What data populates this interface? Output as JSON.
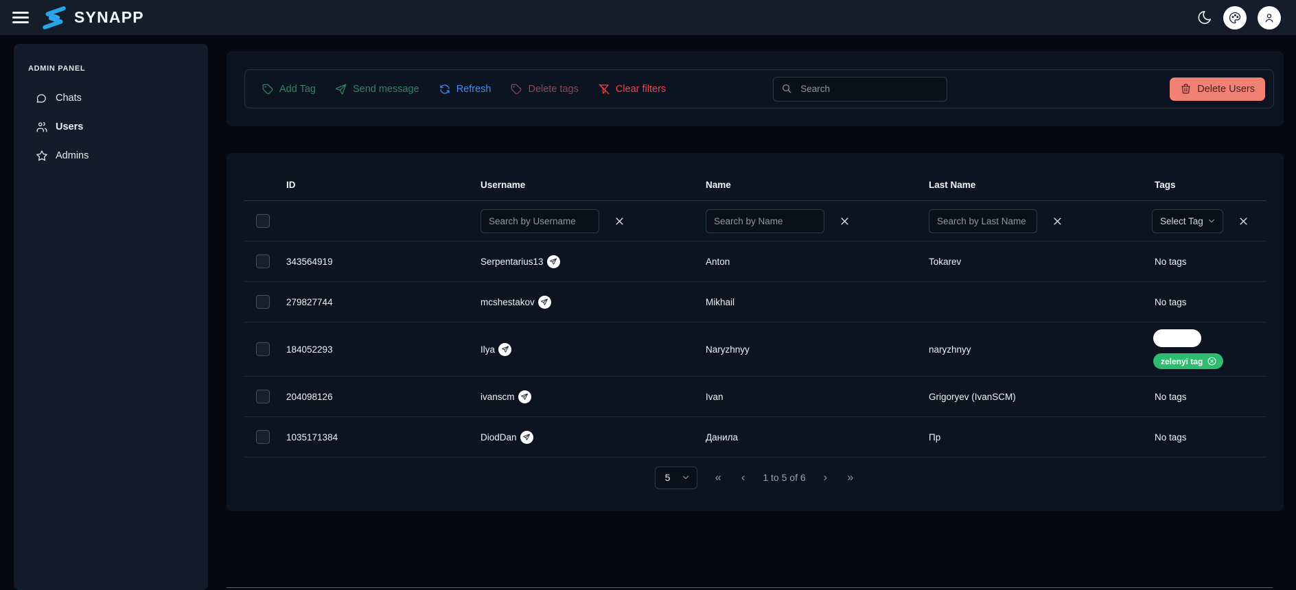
{
  "app": {
    "name": "SYNAPP"
  },
  "sidebar": {
    "section": "ADMIN PANEL",
    "items": [
      {
        "label": "Chats",
        "active": false
      },
      {
        "label": "Users",
        "active": true
      },
      {
        "label": "Admins",
        "active": false
      }
    ]
  },
  "toolbar": {
    "add_tag": "Add Tag",
    "send_message": "Send message",
    "refresh": "Refresh",
    "delete_tags": "Delete tags",
    "clear_filters": "Clear filters",
    "search_placeholder": "Search",
    "delete_users": "Delete Users"
  },
  "table": {
    "columns": {
      "id": "ID",
      "username": "Username",
      "name": "Name",
      "last_name": "Last Name",
      "tags": "Tags"
    },
    "filters": {
      "username_placeholder": "Search by Username",
      "name_placeholder": "Search by Name",
      "last_name_placeholder": "Search by Last Name",
      "tag_select_label": "Select Tag"
    },
    "no_tags_label": "No tags",
    "rows": [
      {
        "id": "343564919",
        "username": "Serpentarius13",
        "name": "Anton",
        "last_name": "Tokarev",
        "tags_text": "No tags"
      },
      {
        "id": "279827744",
        "username": "mcshestakov",
        "name": "Mikhail",
        "last_name": "",
        "tags_text": "No tags"
      },
      {
        "id": "184052293",
        "username": "Ilya",
        "name": "Naryzhnyy",
        "last_name": "naryzhnyy",
        "tags": [
          {
            "label": "",
            "color": "#ffffff"
          },
          {
            "label": "zelenyi tag",
            "color": "#2ebd70"
          }
        ]
      },
      {
        "id": "204098126",
        "username": "ivanscm",
        "name": "Ivan",
        "last_name": "Grigoryev (IvanSCM)",
        "tags_text": "No tags"
      },
      {
        "id": "1035171384",
        "username": "DiodDan",
        "name": "Данила",
        "last_name": "Пр",
        "tags_text": "No tags"
      }
    ]
  },
  "pagination": {
    "page_size": "5",
    "first_label": "«",
    "prev_label": "‹",
    "range_text": "1 to 5 of 6",
    "next_label": "›",
    "last_label": "»"
  },
  "colors": {
    "page_bg": "#05080f",
    "topbar_bg": "#151d2b",
    "sidebar_bg": "#141c2b",
    "card_bg": "#0d1421",
    "accent_green": "#3aa071",
    "accent_blue": "#3f8cfa",
    "muted_red": "#a85763",
    "accent_red": "#ef4348",
    "delete_button_bg": "#f08173",
    "tag_green": "#2ebd70"
  }
}
